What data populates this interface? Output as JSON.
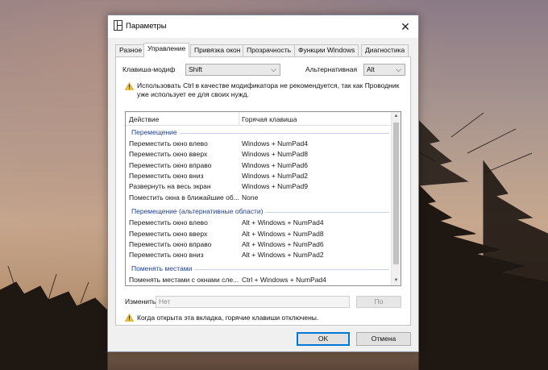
{
  "window": {
    "title": "Параметры",
    "close_glyph": "✕"
  },
  "tabs": [
    {
      "label": "Разное"
    },
    {
      "label": "Управление",
      "active": true
    },
    {
      "label": "Привязка окон"
    },
    {
      "label": "Прозрачность"
    },
    {
      "label": "Функции Windows"
    },
    {
      "label": "Диагностика"
    }
  ],
  "modifier": {
    "label": "Клавиша-модиф",
    "value": "Shift",
    "alt_label": "Альтернативная",
    "alt_value": "Alt"
  },
  "warning_ctrl": {
    "line1": "Использовать Ctrl в качестве модификатора не рекомендуется, так как Проводник",
    "line2": "уже использует ее для своих нужд."
  },
  "list": {
    "col_action": "Действие",
    "col_hotkey": "Горячая клавиша",
    "groups": [
      {
        "title": "Перемещение",
        "rows": [
          {
            "action": "Переместить окно влево",
            "hotkey": "Windows + NumPad4"
          },
          {
            "action": "Переместить окно вверх",
            "hotkey": "Windows + NumPad8"
          },
          {
            "action": "Переместить окно вправо",
            "hotkey": "Windows + NumPad6"
          },
          {
            "action": "Переместить окно вниз",
            "hotkey": "Windows + NumPad2"
          },
          {
            "action": "Развернуть на весь экран",
            "hotkey": "Windows + NumPad9"
          },
          {
            "action": "Поместить окна в ближайшие об...",
            "hotkey": "None"
          }
        ]
      },
      {
        "title": "Перемещение (альтернативные области)",
        "rows": [
          {
            "action": "Переместить окно влево",
            "hotkey": "Alt + Windows + NumPad4"
          },
          {
            "action": "Переместить окно вверх",
            "hotkey": "Alt + Windows + NumPad8"
          },
          {
            "action": "Переместить окно вправо",
            "hotkey": "Alt + Windows + NumPad6"
          },
          {
            "action": "Переместить окно вниз",
            "hotkey": "Alt + Windows + NumPad2"
          }
        ]
      },
      {
        "title": "Поменять местами",
        "rows": [
          {
            "action": "Поменять местами с окнами сле...",
            "hotkey": "Ctrl + Windows + NumPad4"
          }
        ]
      }
    ]
  },
  "change": {
    "label": "Изменить:",
    "placeholder": "Нет",
    "button": "По"
  },
  "warning_tab": {
    "text": "Когда открыта эта вкладка, горячие клавиши отключены."
  },
  "footer": {
    "ok": "OK",
    "cancel": "Отмена"
  },
  "colors": {
    "accent": "#0078d7",
    "group_title": "#1c3f94",
    "warning": "#f2c12e"
  }
}
